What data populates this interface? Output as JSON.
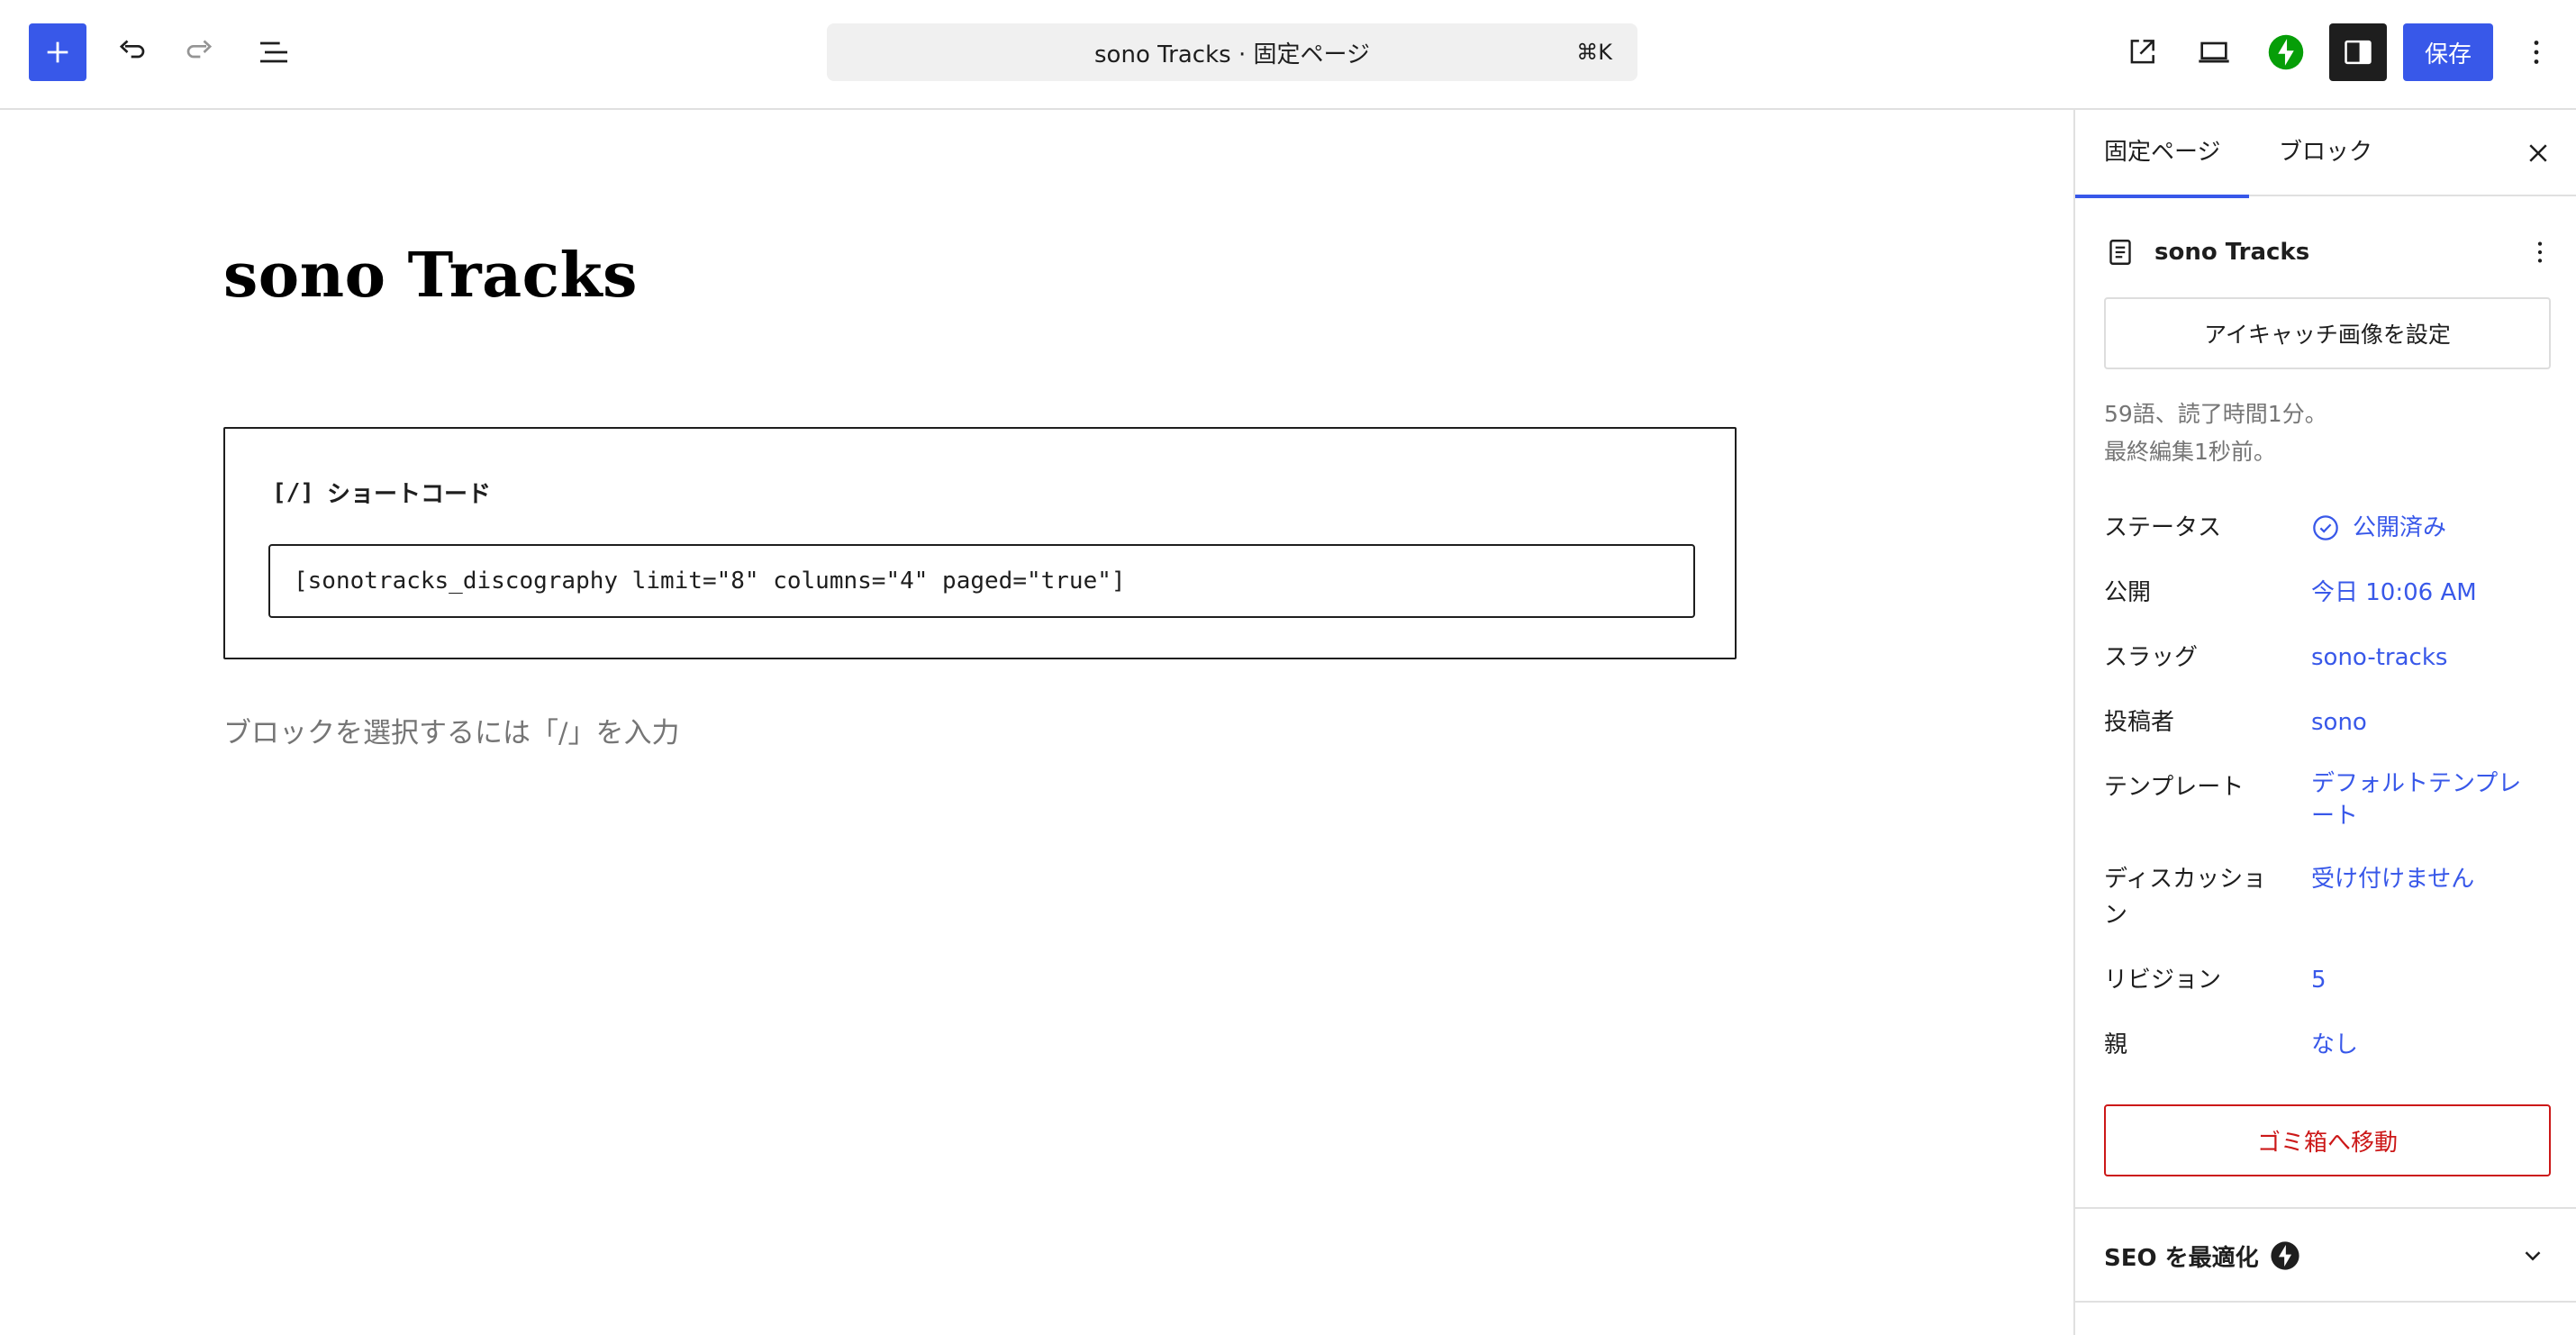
{
  "toolbar": {
    "command_bar_title": "sono Tracks · 固定ページ",
    "command_bar_shortcut": "⌘K",
    "save_label": "保存",
    "icons": {
      "add": "plus-icon",
      "undo": "undo-icon",
      "redo": "redo-icon",
      "list_view": "list-view-icon",
      "view": "external-link-icon",
      "preview": "desktop-preview-icon",
      "jetpack": "jetpack-bolt-icon",
      "settings": "sidebar-toggle-icon",
      "options": "more-vertical-icon"
    },
    "colors": {
      "accent": "#3858e9",
      "jetpack": "#069e08",
      "dark": "#1e1e1e"
    }
  },
  "editor": {
    "post_title": "sono Tracks",
    "shortcode_block": {
      "icon_text": "[/]",
      "label": "ショートコード",
      "value": "[sonotracks_discography limit=\"8\" columns=\"4\" paged=\"true\"]"
    },
    "placeholder": "ブロックを選択するには「/」を入力"
  },
  "sidebar": {
    "tabs": [
      {
        "label": "固定ページ",
        "active": true
      },
      {
        "label": "ブロック",
        "active": false
      }
    ],
    "document": {
      "title": "sono Tracks",
      "icon": "page-icon"
    },
    "featured_image_button": "アイキャッチ画像を設定",
    "meta": {
      "word_count": "59語、読了時間1分。",
      "last_edited": "最終編集1秒前。"
    },
    "properties": [
      {
        "label": "ステータス",
        "value": "公開済み"
      },
      {
        "label": "公開",
        "value": "今日 10:06 AM"
      },
      {
        "label": "スラッグ",
        "value": "sono-tracks"
      },
      {
        "label": "投稿者",
        "value": "sono"
      },
      {
        "label": "テンプレート",
        "value": "デフォルトテンプレート"
      },
      {
        "label": "ディスカッション",
        "value": "受け付けません"
      },
      {
        "label": "リビジョン",
        "value": "5"
      },
      {
        "label": "親",
        "value": "なし"
      }
    ],
    "trash_button": "ゴミ箱へ移動",
    "seo_panel": {
      "title": "SEO を最適化"
    },
    "colors": {
      "link": "#3858e9",
      "danger": "#cc1818",
      "muted": "#757575"
    }
  }
}
